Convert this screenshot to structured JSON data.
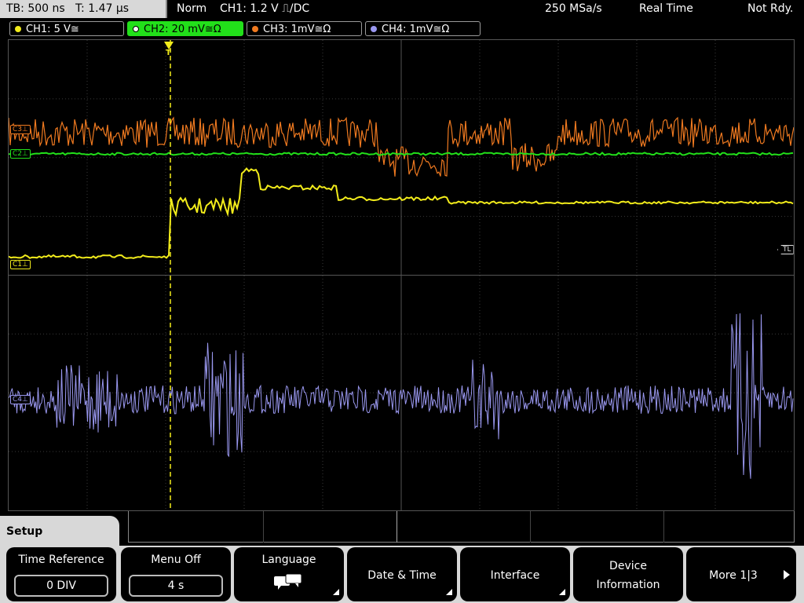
{
  "topbar": {
    "timebase": "TB: 500 ns",
    "trigger_time": "T: 1.47 µs",
    "mode": "Norm",
    "trigger_setting": "CH1: 1.2 V ⎍/DC",
    "sample_rate": "250 MSa/s",
    "acq_mode": "Real Time",
    "state": "Not Rdy."
  },
  "channels": [
    {
      "label": "CH1: 5 V≅",
      "color": "#f2ec1b",
      "marker": "C1⊥"
    },
    {
      "label": "CH2: 20 mV≅Ω",
      "color": "#22e01a",
      "marker": "C2⊥"
    },
    {
      "label": "CH3: 1mV≅Ω",
      "color": "#f07a20",
      "marker": "C3⊥"
    },
    {
      "label": "CH4: 1mV≅Ω",
      "color": "#9a98f0",
      "marker": "C4⊥"
    }
  ],
  "trigger_level_label": "TL",
  "trigger_marker": "T",
  "menu": {
    "title": "Setup",
    "time_reference": {
      "label": "Time Reference",
      "value": "0 DIV"
    },
    "menu_off": {
      "label": "Menu Off",
      "value": "4 s"
    },
    "language": {
      "label": "Language"
    },
    "date_time": {
      "label": "Date & Time"
    },
    "interface": {
      "label": "Interface"
    },
    "device_info": {
      "label1": "Device",
      "label2": "Information"
    },
    "more": {
      "label": "More 1|3"
    }
  },
  "icons": {
    "language": "speech-bubbles-icon",
    "more": "arrow-right-icon"
  }
}
